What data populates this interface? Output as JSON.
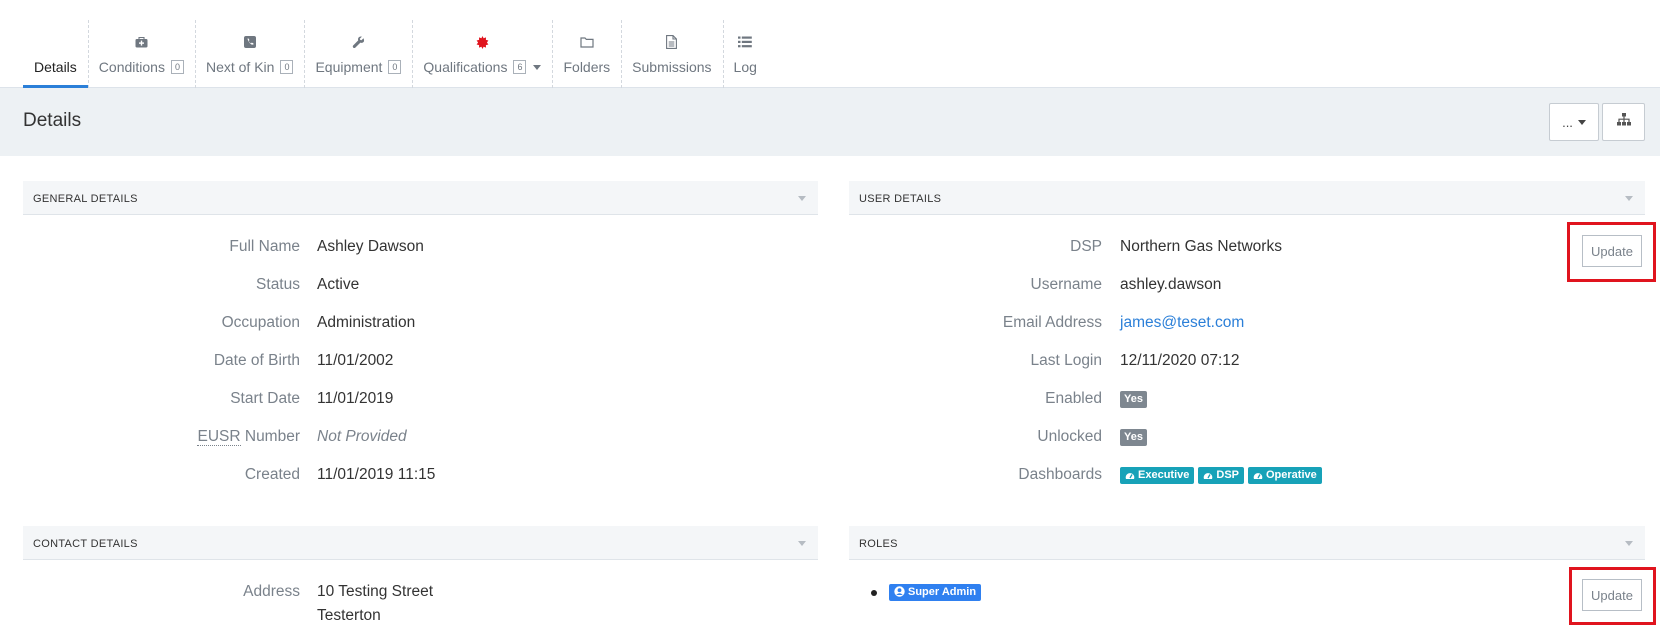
{
  "tabs": [
    {
      "label": "Details",
      "icon": "none",
      "count": null,
      "active": true
    },
    {
      "label": "Conditions",
      "icon": "medkit-icon",
      "count": "0"
    },
    {
      "label": "Next of Kin",
      "icon": "phone-icon",
      "count": "0"
    },
    {
      "label": "Equipment",
      "icon": "wrench-icon",
      "count": "0"
    },
    {
      "label": "Qualifications",
      "icon": "certificate-icon",
      "count": "6",
      "has_dropdown": true
    },
    {
      "label": "Folders",
      "icon": "folder-icon",
      "count": null
    },
    {
      "label": "Submissions",
      "icon": "file-icon",
      "count": null
    },
    {
      "label": "Log",
      "icon": "list-icon",
      "count": null
    }
  ],
  "header": {
    "title": "Details",
    "more_label": "...",
    "background": "#edf1f4"
  },
  "general": {
    "title": "GENERAL DETAILS",
    "fields": [
      {
        "label": "Full Name",
        "value": "Ashley Dawson"
      },
      {
        "label": "Status",
        "value": "Active"
      },
      {
        "label": "Occupation",
        "value": "Administration"
      },
      {
        "label": "Date of Birth",
        "value": "11/01/2002"
      },
      {
        "label": "Start Date",
        "value": "11/01/2019"
      },
      {
        "label_abbr": "EUSR",
        "label_rest": " Number",
        "value": "Not Provided"
      },
      {
        "label": "Created",
        "value": "11/01/2019 11:15"
      }
    ]
  },
  "user": {
    "title": "USER DETAILS",
    "fields": [
      {
        "label": "DSP",
        "value": "Northern Gas Networks"
      },
      {
        "label": "Username",
        "value": "ashley.dawson"
      },
      {
        "label": "Email Address",
        "value": "james@teset.com"
      },
      {
        "label": "Last Login",
        "value": "12/11/2020 07:12"
      },
      {
        "label": "Enabled",
        "value": "Yes"
      },
      {
        "label": "Unlocked",
        "value": "Yes"
      },
      {
        "label": "Dashboards",
        "values": [
          "Executive",
          "DSP",
          "Operative"
        ]
      }
    ],
    "update_label": "Update"
  },
  "contact": {
    "title": "CONTACT DETAILS",
    "address_label": "Address",
    "address_line1": "10 Testing Street",
    "address_line2": "Testerton"
  },
  "roles": {
    "title": "ROLES",
    "items": [
      "Super Admin"
    ],
    "update_label": "Update"
  },
  "colors": {
    "accent": "#2b7fd8",
    "teal_badge": "#17a2b8",
    "grey_badge": "#7e8790",
    "role_badge": "#2f80f0",
    "highlight": "#e0141e",
    "qualifications_icon": "#e0141e"
  }
}
